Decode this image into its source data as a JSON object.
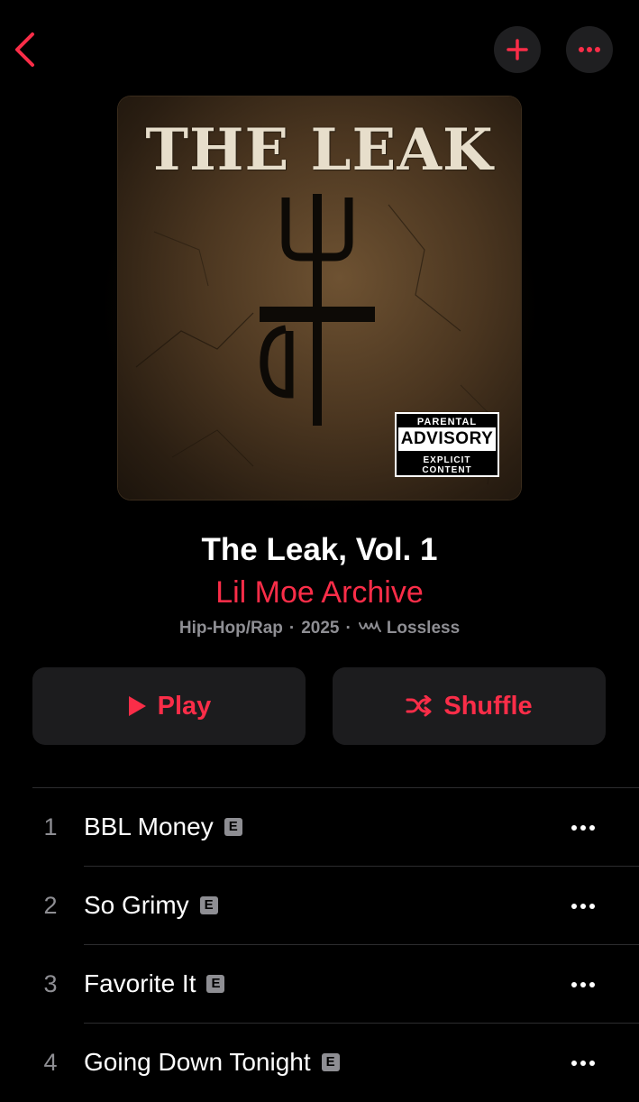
{
  "nav": {
    "back_icon": "chevron-left-icon",
    "add_icon": "plus-icon",
    "more_icon": "ellipsis-icon",
    "accent_color": "#fa2d48"
  },
  "artwork": {
    "title_text": "THE LEAK",
    "advisory_top": "PARENTAL",
    "advisory_mid": "ADVISORY",
    "advisory_bot": "EXPLICIT CONTENT"
  },
  "album": {
    "title": "The Leak, Vol. 1",
    "artist": "Lil Moe Archive",
    "genre": "Hip-Hop/Rap",
    "year": "2025",
    "quality": "Lossless",
    "quality_icon": "lossless-icon"
  },
  "actions": {
    "play_label": "Play",
    "shuffle_label": "Shuffle"
  },
  "tracks": [
    {
      "number": "1",
      "title": "BBL Money",
      "badge": "E"
    },
    {
      "number": "2",
      "title": "So Grimy",
      "badge": "E"
    },
    {
      "number": "3",
      "title": "Favorite It",
      "badge": "E"
    },
    {
      "number": "4",
      "title": "Going Down Tonight",
      "badge": "E"
    }
  ]
}
